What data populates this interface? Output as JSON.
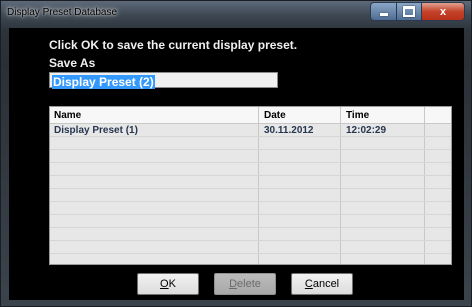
{
  "window": {
    "title": "Display Preset Database",
    "minimize_label": "",
    "maximize_label": "",
    "close_label": "x"
  },
  "dialog": {
    "message": "Click OK to save the current display preset.",
    "save_as_label": "Save As",
    "name_value": "Display Preset (2)"
  },
  "table": {
    "columns": [
      "Name",
      "Date",
      "Time"
    ],
    "rows": [
      {
        "name": "Display Preset (1)",
        "date": "30.11.2012",
        "time": "12:02:29"
      }
    ]
  },
  "buttons": {
    "ok": {
      "first": "O",
      "rest": "K"
    },
    "delete": {
      "first": "D",
      "rest": "elete"
    },
    "cancel": {
      "first": "C",
      "rest": "ancel"
    }
  },
  "colors": {
    "selection": "#3399ff",
    "close_button": "#c4432a",
    "grid_bg": "#e7e7e7"
  }
}
